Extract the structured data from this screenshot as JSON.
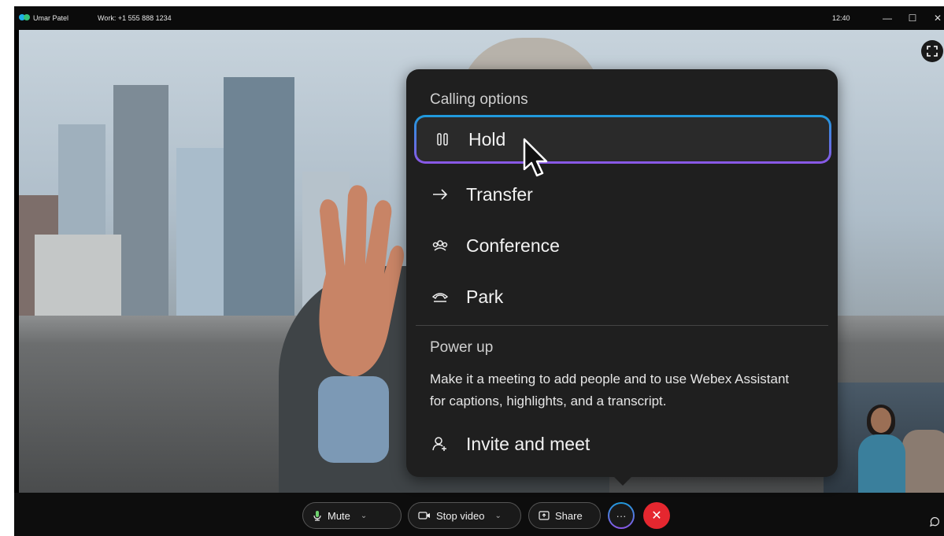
{
  "titlebar": {
    "user_name": "Umar Patel",
    "work_line": "Work: +1 555 888 1234",
    "time": "12:40",
    "minimize": "—",
    "maximize": "☐",
    "close": "✕"
  },
  "menu": {
    "section_title": "Calling options",
    "items": [
      {
        "label": "Hold",
        "icon": "pause-icon",
        "selected": true
      },
      {
        "label": "Transfer",
        "icon": "arrow-right-icon",
        "selected": false
      },
      {
        "label": "Conference",
        "icon": "conference-icon",
        "selected": false
      },
      {
        "label": "Park",
        "icon": "phone-park-icon",
        "selected": false
      }
    ],
    "powerup_title": "Power up",
    "powerup_desc": "Make it a meeting to add people and to use Webex Assistant for captions, highlights, and a transcript.",
    "invite_label": "Invite and meet"
  },
  "toolbar": {
    "mute_label": "Mute",
    "stop_video_label": "Stop video",
    "share_label": "Share",
    "more_label": "···",
    "end_label": "✕"
  },
  "colors": {
    "accent_blue": "#1e9bdc",
    "accent_purple": "#8b57e6",
    "end_call_red": "#e5272f",
    "menu_bg": "#1f1f1f"
  }
}
